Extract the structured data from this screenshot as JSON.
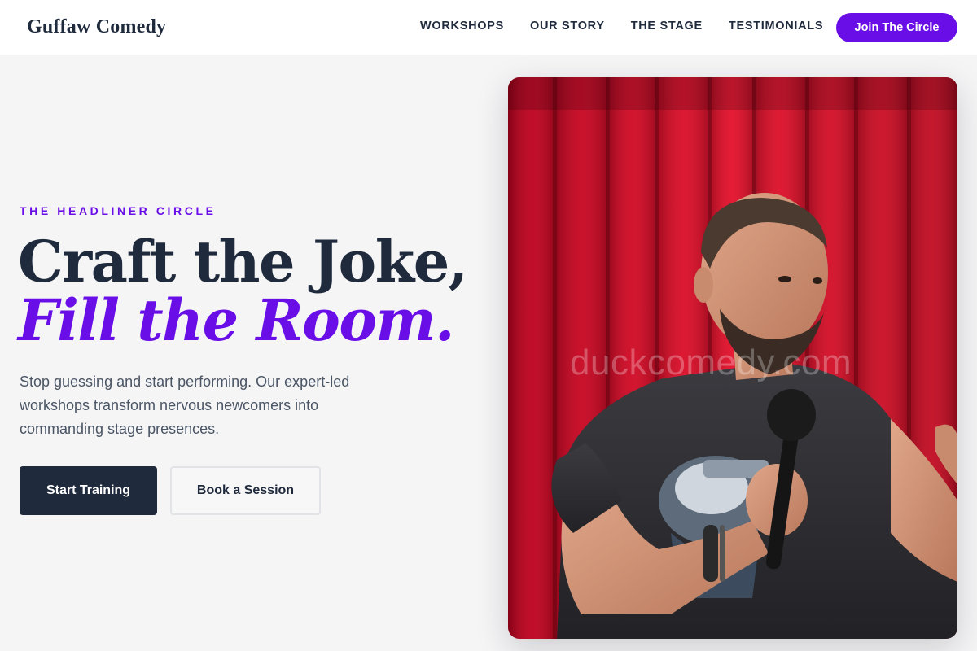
{
  "header": {
    "brand": "Guffaw Comedy",
    "nav": [
      "WORKSHOPS",
      "OUR STORY",
      "THE STAGE",
      "TESTIMONIALS"
    ],
    "cta": "Join The Circle"
  },
  "hero": {
    "eyebrow": "THE HEADLINER CIRCLE",
    "headline_line1": "Craft the Joke,",
    "headline_line2": "Fill the Room.",
    "subtext": "Stop guessing and start performing. Our expert-led workshops transform nervous newcomers into commanding stage presences.",
    "primary_button": "Start Training",
    "secondary_button": "Book a Session",
    "image_watermark": "duckcomedy.com"
  },
  "colors": {
    "accent": "#6a0ee8",
    "navy": "#1f2a3c",
    "background": "#f5f5f6",
    "curtain": "#c8102e"
  },
  "icons": {
    "hero_image": "comedian-with-microphone-photo"
  }
}
